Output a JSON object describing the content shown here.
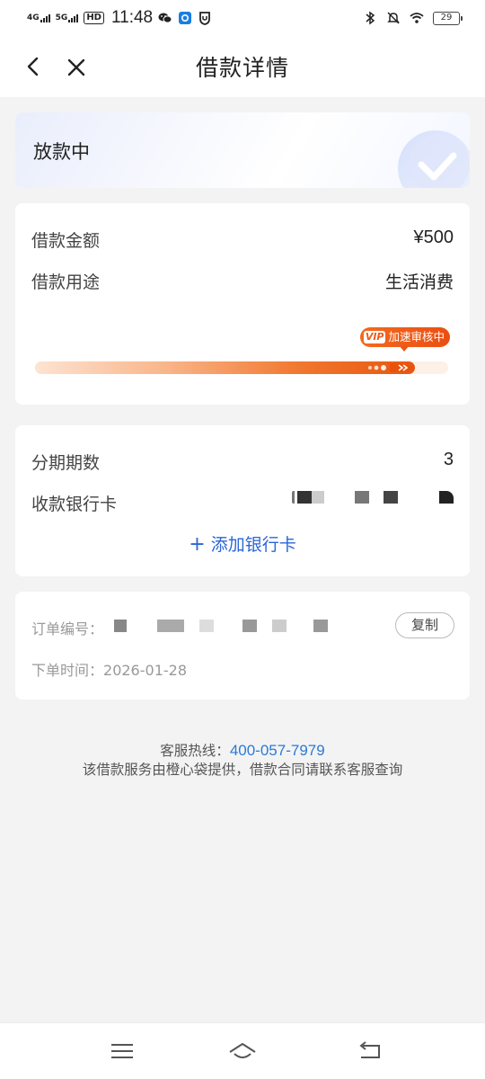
{
  "status_bar": {
    "net1": "4G",
    "net2": "5G",
    "hd": "HD",
    "time": "11:48",
    "battery": "29"
  },
  "nav": {
    "title": "借款详情"
  },
  "status_card": {
    "title": "放款中"
  },
  "loan_info": {
    "amount_label": "借款金额",
    "amount_value": "¥500",
    "purpose_label": "借款用途",
    "purpose_value": "生活消费",
    "vip_badge": "VIP",
    "progress_label": "加速审核中",
    "progress": 0.92
  },
  "installment": {
    "periods_label": "分期期数",
    "periods_value": "3",
    "bank_label": "收款银行卡",
    "add_card_label": "添加银行卡"
  },
  "order": {
    "number_label": "订单编号：",
    "copy_label": "复制",
    "time_label": "下单时间：",
    "time_value": "2026-01-28"
  },
  "footer": {
    "hotline_label": "客服热线：",
    "hotline_number": "400-057-7979",
    "disclaimer": "该借款服务由橙心袋提供，借款合同请联系客服查询"
  },
  "colors": {
    "accent_blue": "#2b66d9",
    "hotline_blue": "#2a7bd6",
    "progress_orange": "#e8560f",
    "background": "#f3f3f3"
  }
}
